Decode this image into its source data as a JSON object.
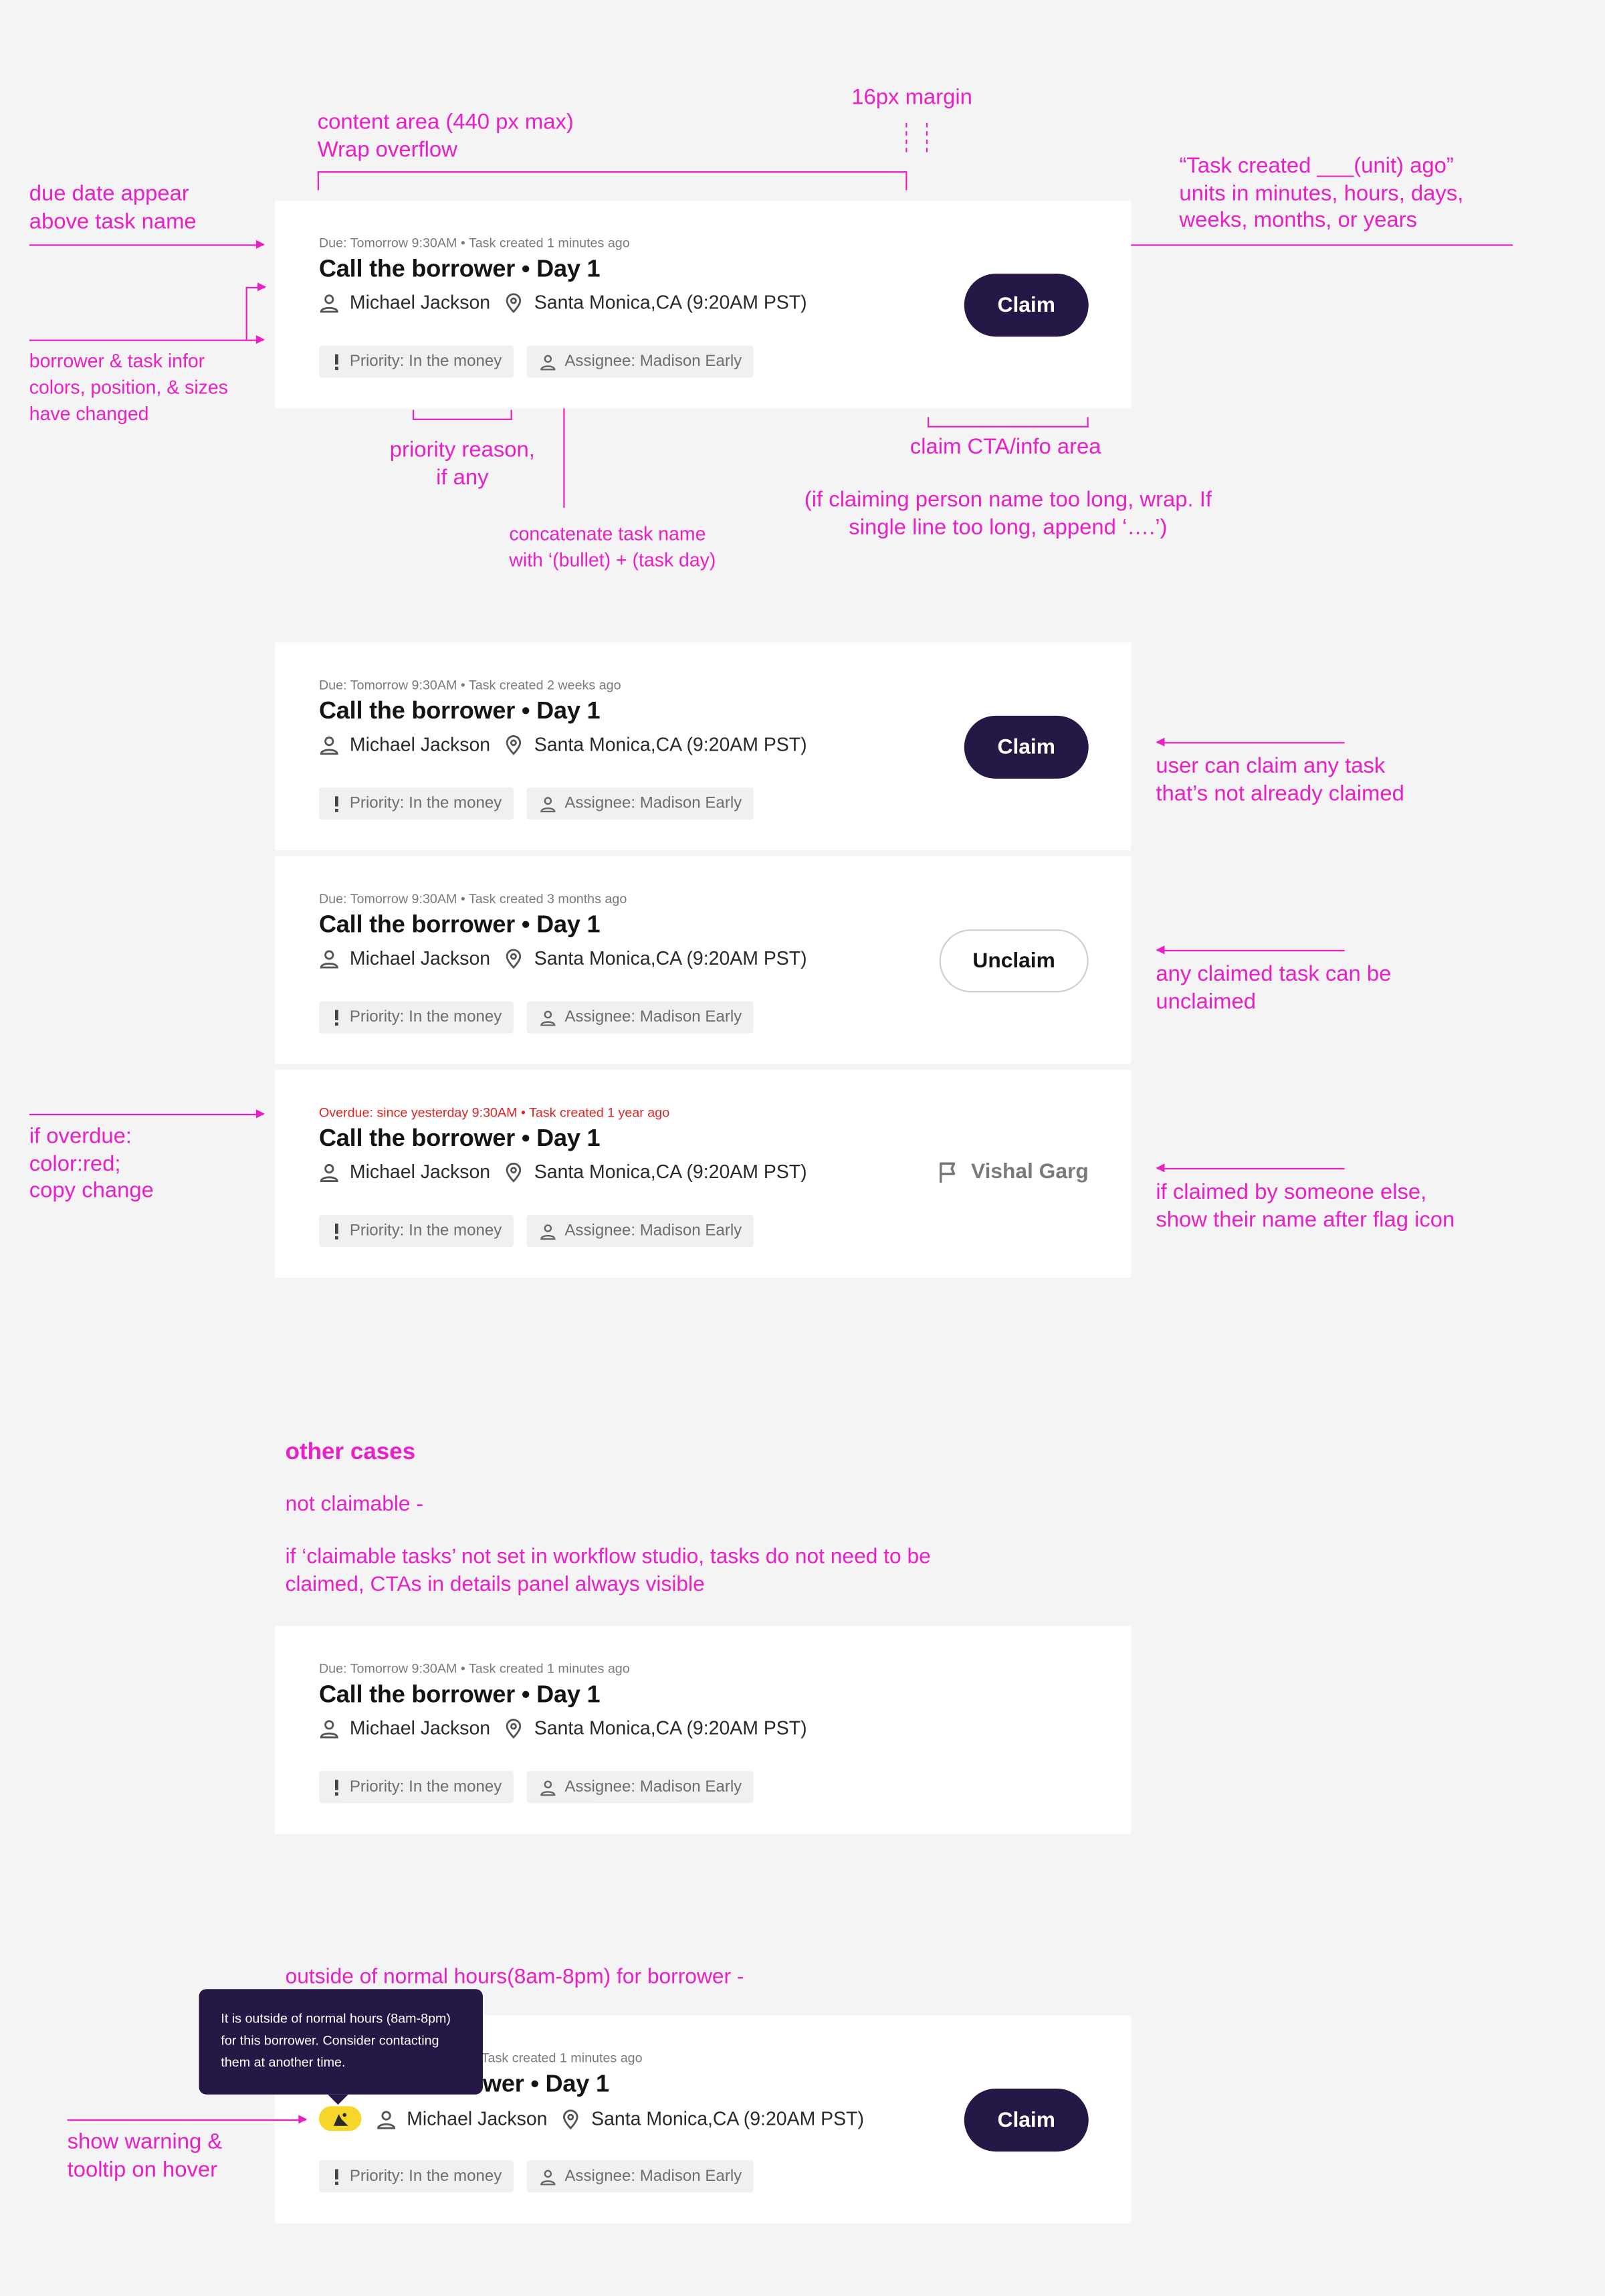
{
  "annotations": {
    "content_area": "content area (440 px max)",
    "wrap_overflow": "Wrap overflow",
    "margin": "16px margin",
    "due_date": "due date appear\nabove task name",
    "task_created": "“Task created ___(unit) ago”\nunits in minutes, hours, days,\nweeks, months, or years",
    "borrower_info": "borrower & task infor\ncolors, position, & sizes\nhave changed",
    "priority_reason": "priority reason,\nif any",
    "claim_cta": "claim CTA/info area",
    "claim_wrap": "(if claiming person name too long, wrap. If\nsingle line too long, append ‘….’)",
    "concatenate": "concatenate task name\nwith ‘(bullet) + (task day)",
    "user_can_claim": "user can claim any task\nthat’s not already claimed",
    "claimed_unclaimed": "any claimed task can be\nunclaimed",
    "overdue": "if overdue:\ncolor:red;\ncopy change",
    "claimed_someone": "if claimed by someone else,\nshow their name after flag icon",
    "other_cases": "other cases",
    "not_claimable": "not claimable -",
    "claimable_note": "if ‘claimable tasks’ not set in workflow studio, tasks do not need to be\nclaimed, CTAs in details panel always visible",
    "outside_hours": "outside of normal hours(8am-8pm) for borrower -",
    "show_warning": "show warning &\ntooltip on hover"
  },
  "common": {
    "title": "Call the borrower • Day 1",
    "borrower": "Michael Jackson",
    "location": "Santa Monica,CA (9:20AM PST)",
    "priority": "Priority: In the money",
    "assignee": "Assignee: Madison Early",
    "claim": "Claim",
    "unclaim": "Unclaim"
  },
  "cards": {
    "c1": {
      "meta": "Due: Tomorrow 9:30AM •  Task created 1 minutes ago"
    },
    "c2": {
      "meta": "Due: Tomorrow 9:30AM • Task created 2 weeks ago"
    },
    "c3": {
      "meta": "Due: Tomorrow 9:30AM • Task created 3 months ago"
    },
    "c4": {
      "meta": "Overdue: since yesterday 9:30AM • Task created 1 year ago",
      "claimed_by": "Vishal Garg"
    },
    "c5": {
      "meta": "Due: Tomorrow 9:30AM •  Task created 1 minutes ago"
    },
    "c6": {
      "meta_visible": "Task created 1 minutes ago",
      "title_visible": "wer • Day 1"
    }
  },
  "tooltip": "It is outside of normal hours (8am-8pm) for this borrower. Consider contacting them at another time.",
  "colors": {
    "annotation": "#e91fc7",
    "claim_button": "#261846",
    "overdue": "#e02424",
    "warning": "#f7d62a",
    "background": "#f4f4f4"
  }
}
